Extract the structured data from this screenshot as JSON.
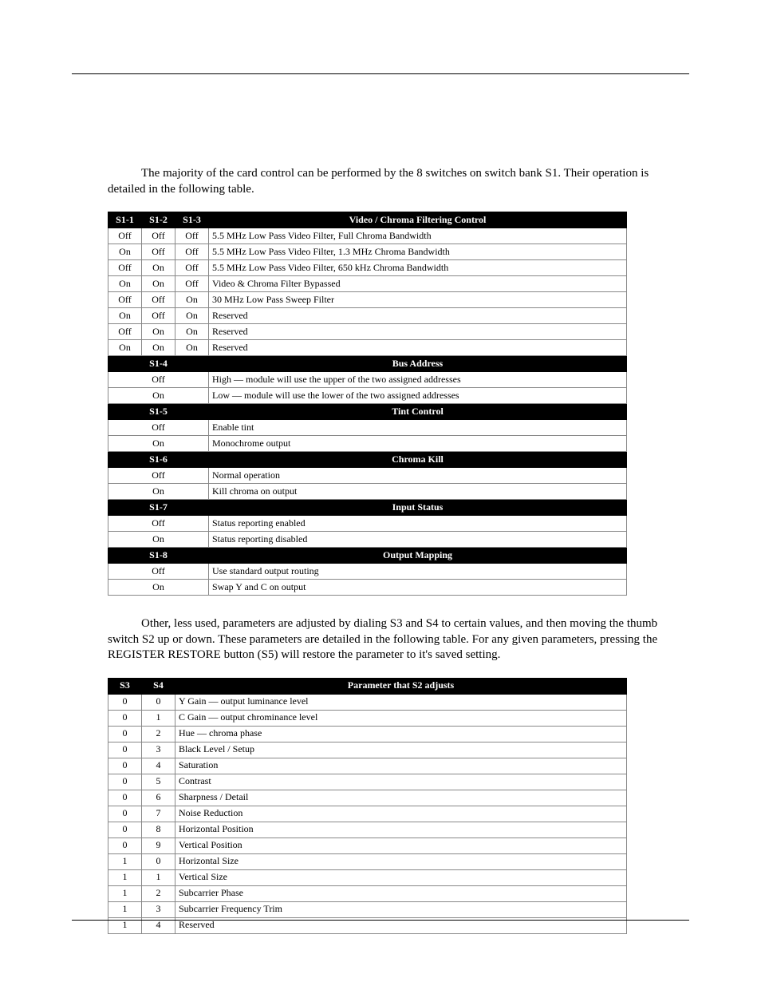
{
  "paragraphs": {
    "p1": "The majority of the card control can be performed by the 8 switches on switch bank S1. Their operation is detailed in the following table.",
    "p2": "Other, less used, parameters are adjusted by dialing S3 and S4 to certain values, and then moving the thumb switch S2 up or down. These parameters are detailed in the following table. For any given parameters, pressing the REGISTER RESTORE button (S5) will restore the parameter to it's saved setting."
  },
  "table1": {
    "header_main": [
      "S1-1",
      "S1-2",
      "S1-3",
      "Video / Chroma Filtering Control"
    ],
    "group1_rows": [
      [
        "Off",
        "Off",
        "Off",
        "5.5 MHz Low Pass Video Filter, Full Chroma Bandwidth"
      ],
      [
        "On",
        "Off",
        "Off",
        "5.5 MHz Low Pass Video Filter, 1.3 MHz Chroma Bandwidth"
      ],
      [
        "Off",
        "On",
        "Off",
        "5.5 MHz Low Pass Video Filter, 650 kHz Chroma Bandwidth"
      ],
      [
        "On",
        "On",
        "Off",
        "Video & Chroma Filter Bypassed"
      ],
      [
        "Off",
        "Off",
        "On",
        "30 MHz Low Pass Sweep Filter"
      ],
      [
        "On",
        "Off",
        "On",
        "Reserved"
      ],
      [
        "Off",
        "On",
        "On",
        "Reserved"
      ],
      [
        "On",
        "On",
        "On",
        "Reserved"
      ]
    ],
    "group2_header": [
      "S1-4",
      "Bus Address"
    ],
    "group2_rows": [
      [
        "Off",
        "High — module will use the upper of the two assigned addresses"
      ],
      [
        "On",
        "Low — module will use the lower of the two assigned addresses"
      ]
    ],
    "group3_header": [
      "S1-5",
      "Tint Control"
    ],
    "group3_rows": [
      [
        "Off",
        "Enable tint"
      ],
      [
        "On",
        "Monochrome output"
      ]
    ],
    "group4_header": [
      "S1-6",
      "Chroma Kill"
    ],
    "group4_rows": [
      [
        "Off",
        "Normal operation"
      ],
      [
        "On",
        "Kill chroma on output"
      ]
    ],
    "group5_header": [
      "S1-7",
      "Input Status"
    ],
    "group5_rows": [
      [
        "Off",
        "Status reporting enabled"
      ],
      [
        "On",
        "Status reporting disabled"
      ]
    ],
    "group6_header": [
      "S1-8",
      "Output Mapping"
    ],
    "group6_rows": [
      [
        "Off",
        "Use standard output routing"
      ],
      [
        "On",
        "Swap Y and C on output"
      ]
    ]
  },
  "table2": {
    "header": [
      "S3",
      "S4",
      "Parameter that S2 adjusts"
    ],
    "rows": [
      [
        "0",
        "0",
        "Y Gain — output luminance level"
      ],
      [
        "0",
        "1",
        "C Gain — output chrominance level"
      ],
      [
        "0",
        "2",
        "Hue — chroma phase"
      ],
      [
        "0",
        "3",
        "Black Level / Setup"
      ],
      [
        "0",
        "4",
        "Saturation"
      ],
      [
        "0",
        "5",
        "Contrast"
      ],
      [
        "0",
        "6",
        "Sharpness / Detail"
      ],
      [
        "0",
        "7",
        "Noise Reduction"
      ],
      [
        "0",
        "8",
        "Horizontal Position"
      ],
      [
        "0",
        "9",
        "Vertical Position"
      ],
      [
        "1",
        "0",
        "Horizontal Size"
      ],
      [
        "1",
        "1",
        "Vertical Size"
      ],
      [
        "1",
        "2",
        "Subcarrier Phase"
      ],
      [
        "1",
        "3",
        "Subcarrier Frequency Trim"
      ],
      [
        "1",
        "4",
        "Reserved"
      ]
    ]
  }
}
